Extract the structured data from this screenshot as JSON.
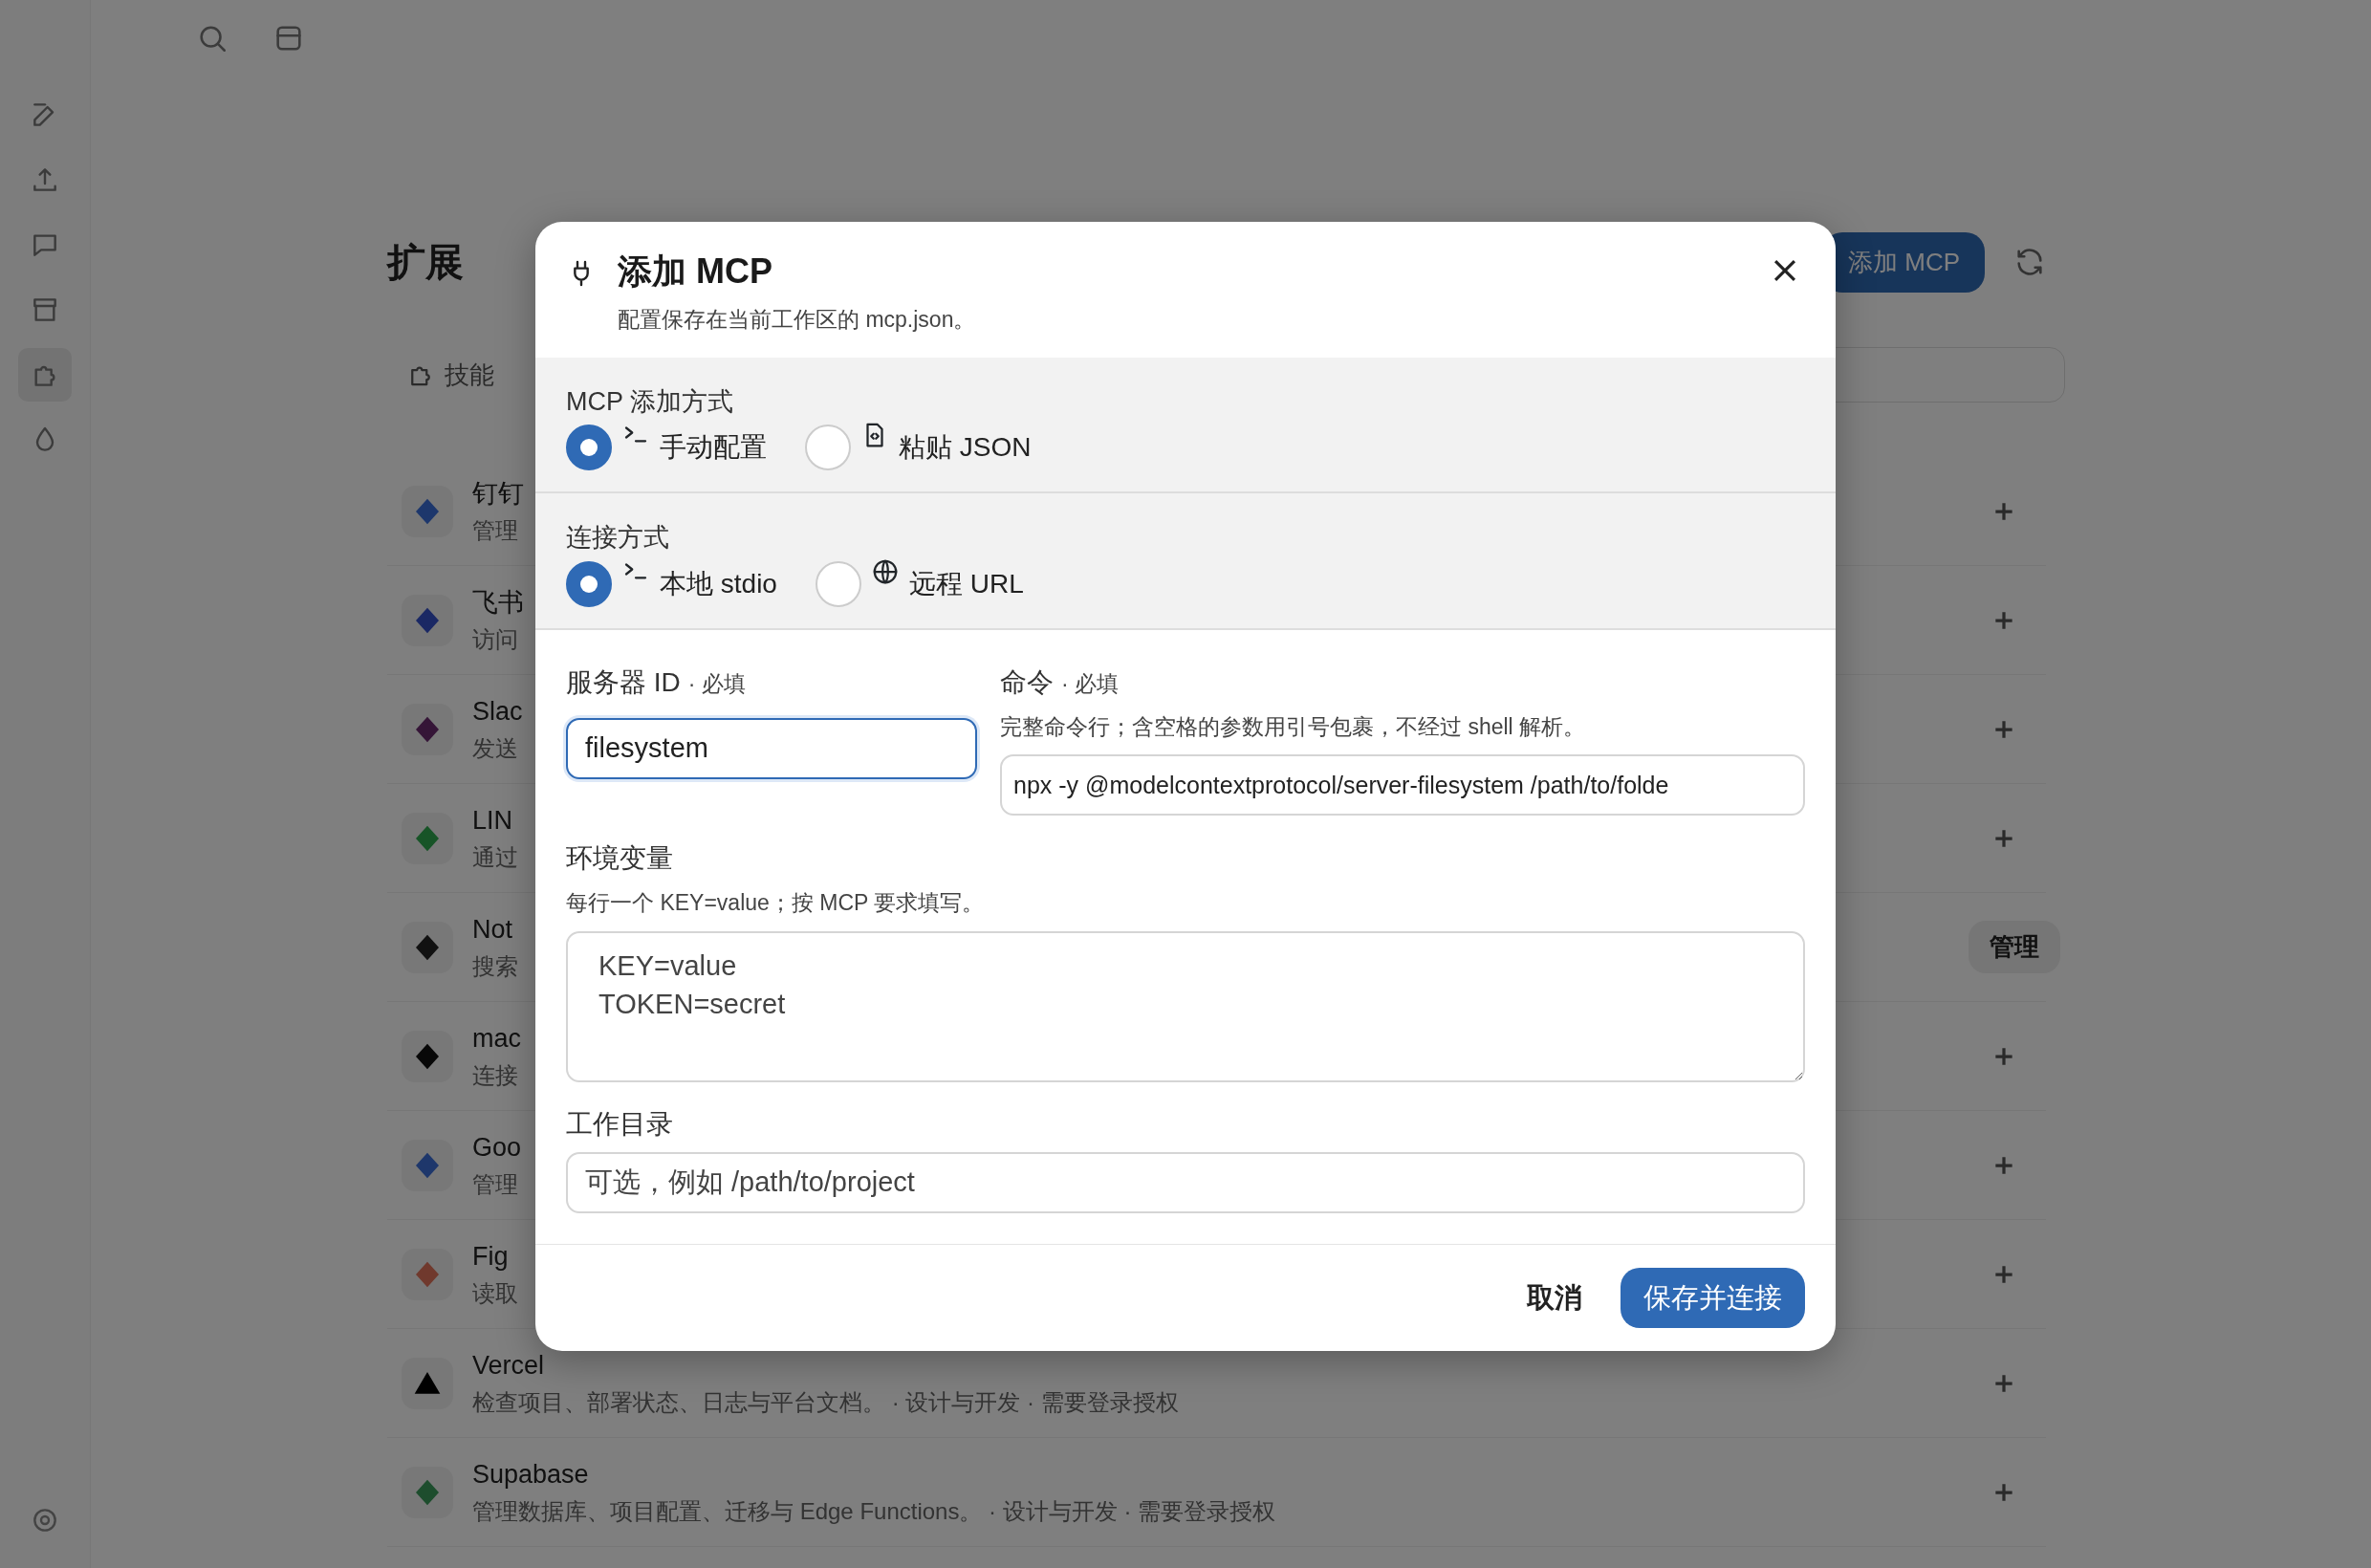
{
  "background": {
    "page_title": "扩展",
    "add_button": "添加 MCP",
    "tab": "技能",
    "items": [
      {
        "name": "钉钉",
        "description": "管理",
        "kind": "add"
      },
      {
        "name": "飞书",
        "description": "访问",
        "kind": "add"
      },
      {
        "name": "Slac",
        "description": "发送",
        "kind": "add"
      },
      {
        "name": "LIN",
        "description": "通过",
        "kind": "add"
      },
      {
        "name": "Not",
        "description": "搜索",
        "kind": "manage",
        "action_label": "管理"
      },
      {
        "name": "mac",
        "description": "连接",
        "kind": "add"
      },
      {
        "name": "Goo",
        "description": "管理",
        "kind": "add"
      },
      {
        "name": "Fig",
        "description": "读取",
        "kind": "add"
      },
      {
        "name": "Vercel",
        "description": "检查项目、部署状态、日志与平台文档。 · 设计与开发 · 需要登录授权",
        "kind": "add"
      },
      {
        "name": "Supabase",
        "description": "管理数据库、项目配置、迁移与 Edge Functions。 · 设计与开发 · 需要登录授权",
        "kind": "add"
      }
    ]
  },
  "dialog": {
    "title": "添加 MCP",
    "subtitle": "配置保存在当前工作区的 mcp.json。",
    "choice_groups": [
      {
        "label": "MCP 添加方式",
        "options": [
          {
            "label": "手动配置",
            "selected": true
          },
          {
            "label": "粘贴 JSON",
            "selected": false
          }
        ]
      },
      {
        "label": "连接方式",
        "options": [
          {
            "label": "本地 stdio",
            "selected": true
          },
          {
            "label": "远程 URL",
            "selected": false
          }
        ]
      }
    ],
    "server_id": {
      "label": "服务器 ID",
      "required": "· 必填",
      "value": "filesystem",
      "focused": true
    },
    "command": {
      "label": "命令",
      "required": "· 必填",
      "help": "完整命令行；含空格的参数用引号包裹，不经过 shell 解析。",
      "value": "npx -y @modelcontextprotocol/server-filesystem /path/to/folde"
    },
    "env": {
      "label": "环境变量",
      "help": "每行一个 KEY=value；按 MCP 要求填写。",
      "placeholder": "KEY=value\nTOKEN=secret"
    },
    "workdir": {
      "label": "工作目录",
      "placeholder": "可选，例如 /path/to/project"
    },
    "buttons": {
      "cancel": "取消",
      "save": "保存并连接"
    }
  }
}
